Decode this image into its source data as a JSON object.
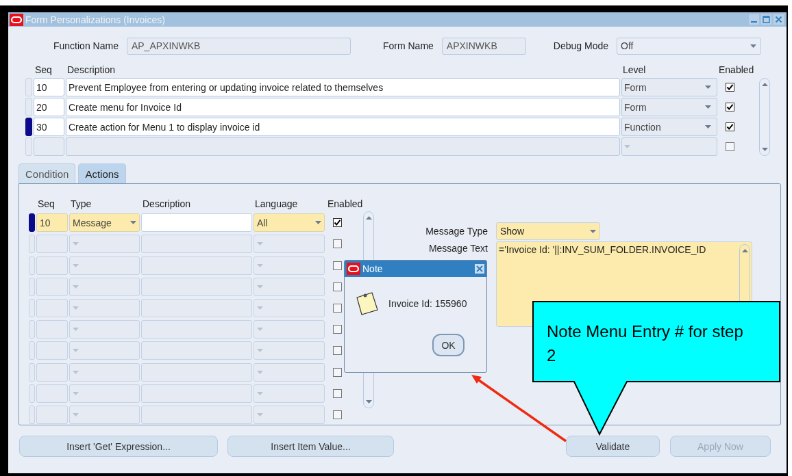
{
  "window": {
    "title": "Form Personalizations (Invoices)"
  },
  "header": {
    "function_name": {
      "label": "Function Name",
      "value": "AP_APXINWKB"
    },
    "form_name": {
      "label": "Form Name",
      "value": "APXINWKB"
    },
    "debug_mode": {
      "label": "Debug Mode",
      "value": "Off"
    }
  },
  "rules": {
    "columns": [
      "Seq",
      "Description",
      "Level",
      "Enabled"
    ],
    "rows": [
      {
        "seq": "10",
        "description": "Prevent Employee from entering or updating invoice related to themselves",
        "level": "Form",
        "enabled": true,
        "selected": false
      },
      {
        "seq": "20",
        "description": "Create menu for Invoice Id",
        "level": "Form",
        "enabled": true,
        "selected": false
      },
      {
        "seq": "30",
        "description": "Create action for Menu 1 to display invoice id",
        "level": "Function",
        "enabled": true,
        "selected": true
      },
      {
        "enabled": false,
        "selected": false
      }
    ]
  },
  "tabs": [
    {
      "label": "Condition",
      "selected": false
    },
    {
      "label": "Actions",
      "selected": true
    }
  ],
  "actions": {
    "columns": [
      "Seq",
      "Type",
      "Description",
      "Language",
      "Enabled"
    ],
    "rows": [
      {
        "seq": "10",
        "type": "Message",
        "language": "All",
        "enabled": true,
        "selected": true
      },
      {
        "enabled": false,
        "selected": false
      },
      {
        "enabled": false,
        "selected": false
      },
      {
        "enabled": false,
        "selected": false
      },
      {
        "enabled": false,
        "selected": false
      },
      {
        "enabled": false,
        "selected": false
      },
      {
        "enabled": false,
        "selected": false
      },
      {
        "enabled": false,
        "selected": false
      },
      {
        "enabled": false,
        "selected": false
      },
      {
        "enabled": false,
        "selected": false
      }
    ]
  },
  "message": {
    "type": {
      "label": "Message Type",
      "value": "Show"
    },
    "text": {
      "label": "Message Text",
      "value": "='Invoice Id: '||:INV_SUM_FOLDER.INVOICE_ID"
    }
  },
  "note_dialog": {
    "title": "Note",
    "message": "Invoice Id: 155960",
    "button": "OK"
  },
  "callout": {
    "text": "Note Menu Entry # for step 2"
  },
  "buttons": [
    {
      "label": "Insert 'Get' Expression...",
      "disabled": false
    },
    {
      "label": "Insert Item Value...",
      "disabled": false
    },
    {
      "label": "Validate",
      "disabled": false
    },
    {
      "label": "Apply Now",
      "disabled": true
    }
  ]
}
